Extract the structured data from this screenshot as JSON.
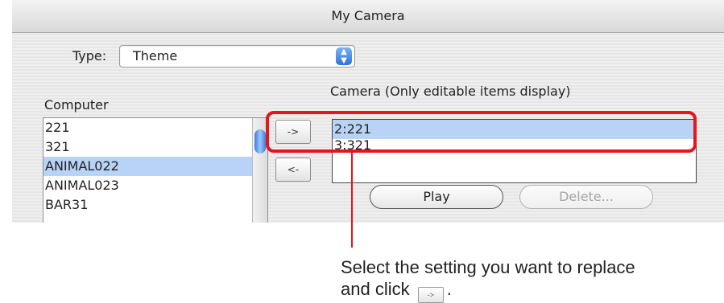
{
  "window": {
    "title": "My Camera"
  },
  "type_selector": {
    "label": "Type:",
    "value": "Theme"
  },
  "computer": {
    "label": "Computer",
    "items": [
      {
        "label": "221",
        "selected": false
      },
      {
        "label": "321",
        "selected": false
      },
      {
        "label": "ANIMAL022",
        "selected": true
      },
      {
        "label": "ANIMAL023",
        "selected": false
      },
      {
        "label": "BAR31",
        "selected": false
      }
    ]
  },
  "transfer": {
    "to_camera_label": "->",
    "to_computer_label": "<-"
  },
  "camera": {
    "label": "Camera (Only editable items display)",
    "items": [
      {
        "label": "2:221",
        "selected": true
      },
      {
        "label": "3:321",
        "selected": false
      }
    ]
  },
  "buttons": {
    "play": "Play",
    "delete": "Delete..."
  },
  "annotation": {
    "text_line1": "Select the setting you want to replace",
    "text_prefix": "and click",
    "key_label": "->",
    "text_suffix": ".",
    "color": "#e8131b"
  }
}
